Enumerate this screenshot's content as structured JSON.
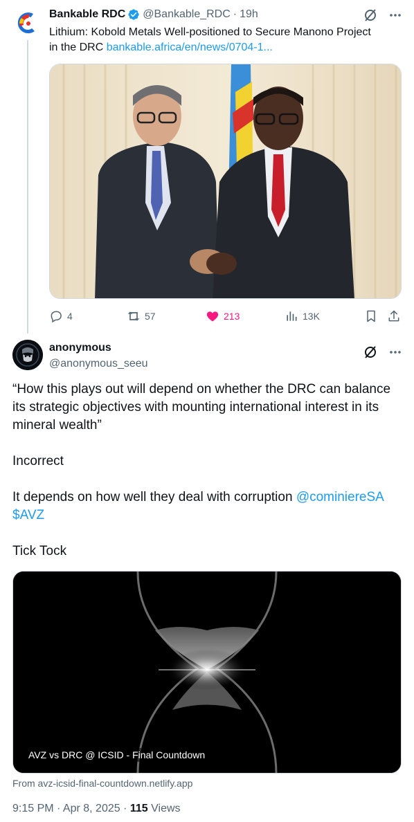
{
  "tweet1": {
    "display_name": "Bankable RDC",
    "handle": "@Bankable_RDC",
    "separator": "·",
    "time": "19h",
    "text": "Lithium: Kobold Metals Well-positioned to Secure Manono Project in the DRC ",
    "link": "bankable.africa/en/news/0704-1...",
    "image_icon": "handshake-photo",
    "stats": {
      "replies": "4",
      "retweets": "57",
      "likes": "213",
      "views": "13K"
    }
  },
  "tweet2": {
    "display_name": "anonymous",
    "handle": "@anonymous_seeu",
    "paragraph1": "“How this plays out will depend on whether the DRC can balance its strategic objectives with mounting international interest in its mineral wealth”",
    "paragraph2": "Incorrect",
    "paragraph3_text": "It depends on how well they deal with corruption ",
    "mention": "@cominiereSA",
    "cashtag": "$AVZ",
    "paragraph4": "Tick Tock",
    "card": {
      "label": "AVZ vs DRC @ ICSID - Final Countdown",
      "source": "From avz-icsid-final-countdown.netlify.app",
      "image_icon": "hourglass-image"
    },
    "timestamp": "9:15 PM · Apr 8, 2025 · ",
    "views_count": "115",
    "views_label": " Views"
  },
  "colors": {
    "accent": "#1d9bf0",
    "like": "#f91880",
    "muted": "#536471",
    "text": "#0f1419"
  }
}
